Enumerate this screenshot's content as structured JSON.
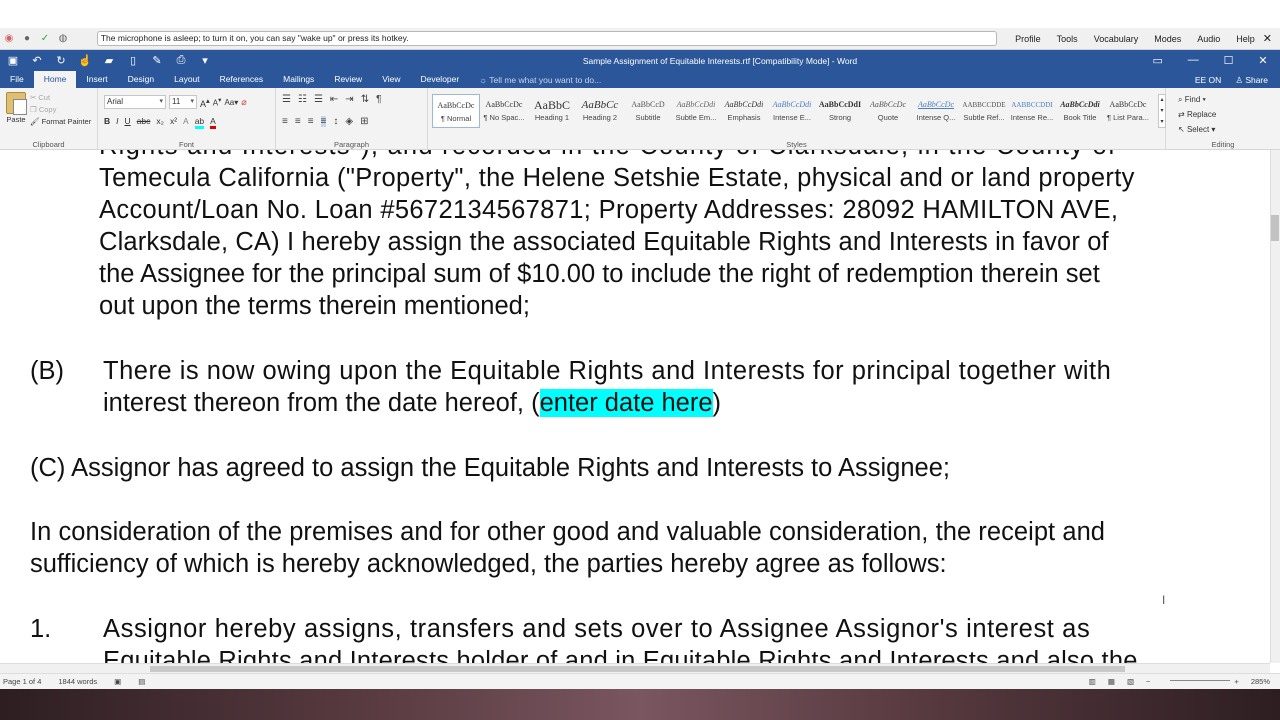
{
  "dragon": {
    "message": "The microphone is asleep; to turn it on, you can say \"wake up\" or press its hotkey.",
    "menu": [
      "Profile",
      "Tools",
      "Vocabulary",
      "Modes",
      "Audio",
      "Help"
    ]
  },
  "window": {
    "title": "Sample Assignment of Equitable Interests.rtf [Compatibility Mode] - Word"
  },
  "tabs": [
    "File",
    "Home",
    "Insert",
    "Design",
    "Layout",
    "References",
    "Mailings",
    "Review",
    "View",
    "Developer"
  ],
  "tell_me": "Tell me what you want to do...",
  "user": {
    "initials": "EE ON",
    "share": "Share"
  },
  "ribbon": {
    "clipboard": {
      "paste": "Paste",
      "cut": "Cut",
      "copy": "Copy",
      "format_painter": "Format Painter",
      "label": "Clipboard"
    },
    "font": {
      "name": "Arial",
      "size": "11",
      "label": "Font"
    },
    "paragraph": {
      "label": "Paragraph"
    },
    "styles": {
      "label": "Styles",
      "items": [
        {
          "preview": "AaBbCcDc",
          "name": "¶ Normal"
        },
        {
          "preview": "AaBbCcDc",
          "name": "¶ No Spac..."
        },
        {
          "preview": "AaBbC",
          "name": "Heading 1"
        },
        {
          "preview": "AaBbCc",
          "name": "Heading 2"
        },
        {
          "preview": "AaBbCcD",
          "name": "Subtitle"
        },
        {
          "preview": "AaBbCcDdi",
          "name": "Subtle Em..."
        },
        {
          "preview": "AaBbCcDdi",
          "name": "Emphasis"
        },
        {
          "preview": "AaBbCcDdi",
          "name": "Intense E..."
        },
        {
          "preview": "AaBbCcDdI",
          "name": "Strong"
        },
        {
          "preview": "AaBbCcDc",
          "name": "Quote"
        },
        {
          "preview": "AaBbCcDc",
          "name": "Intense Q..."
        },
        {
          "preview": "AABBCCDDE",
          "name": "Subtle Ref..."
        },
        {
          "preview": "AABBCCDDI",
          "name": "Intense Re..."
        },
        {
          "preview": "AaBbCcDdi",
          "name": "Book Title"
        },
        {
          "preview": "AaBbCcDc",
          "name": "¶ List Para..."
        }
      ]
    },
    "editing": {
      "find": "Find",
      "replace": "Replace",
      "select": "Select",
      "label": "Editing"
    }
  },
  "document": {
    "lines": [
      "Rights and Interests\"), and recorded in the County of Clarksdale, in the County of",
      "Temecula California (\"Property\", the Helene Setshie Estate, physical and or land property",
      "Account/Loan No. Loan #5672134567871; Property Addresses: 28092 HAMILTON AVE,",
      "Clarksdale, CA) I hereby assign the associated Equitable Rights and Interests in favor of",
      "the Assignee for the principal sum of $10.00 to include the right of redemption therein set",
      "out upon the terms therein mentioned;"
    ],
    "b_marker": "(B)",
    "b_line1": "There is now owing upon the Equitable Rights and Interests for principal together with",
    "b_line2_pre": "interest thereon from the date hereof, (",
    "b_highlight": "enter date here",
    "b_line2_post": ")",
    "c_line": "(C) Assignor has agreed to assign the Equitable Rights and Interests to Assignee;",
    "consideration_1": "In consideration of the premises and for other good and valuable consideration, the receipt and",
    "consideration_2": "sufficiency of which is hereby acknowledged, the parties hereby agree as follows:",
    "item1_marker": "1.",
    "item1_line1": "Assignor hereby assigns, transfers and sets over to Assignee Assignor's interest as",
    "item1_line2": "Equitable Rights and Interests holder of and in Equitable Rights and Interests and also the",
    "highlight_color": "#00ffff"
  },
  "status": {
    "page": "Page 1 of 4",
    "words": "1844 words",
    "zoom": "285%"
  }
}
